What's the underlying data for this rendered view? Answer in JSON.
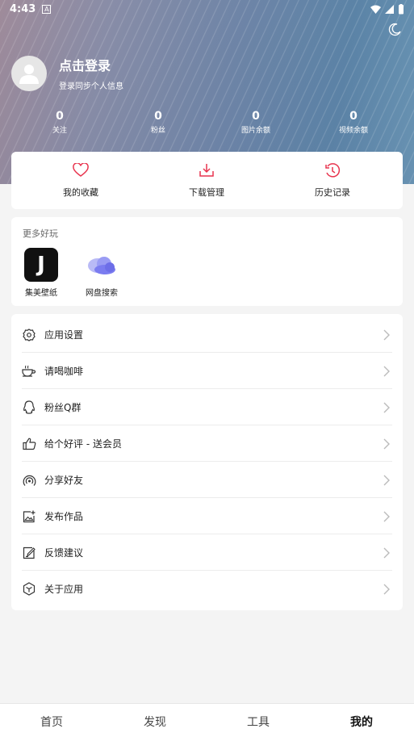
{
  "status_bar": {
    "time": "4:43",
    "notif_letter": "A"
  },
  "profile": {
    "title": "点击登录",
    "subtitle": "登录同步个人信息"
  },
  "stats": [
    {
      "value": "0",
      "label": "关注"
    },
    {
      "value": "0",
      "label": "粉丝"
    },
    {
      "value": "0",
      "label": "图片余额"
    },
    {
      "value": "0",
      "label": "视频余额"
    }
  ],
  "quick": [
    {
      "label": "我的收藏",
      "icon": "heart-icon"
    },
    {
      "label": "下载管理",
      "icon": "download-icon"
    },
    {
      "label": "历史记录",
      "icon": "history-icon"
    }
  ],
  "more": {
    "title": "更多好玩",
    "apps": [
      {
        "label": "集美壁纸",
        "icon": "j-wallpaper-icon",
        "letter": "J"
      },
      {
        "label": "网盘搜索",
        "icon": "cloud-icon"
      }
    ]
  },
  "menu": [
    {
      "label": "应用设置",
      "icon": "gear-icon"
    },
    {
      "label": "请喝咖啡",
      "icon": "coffee-icon"
    },
    {
      "label": "粉丝Q群",
      "icon": "qq-icon"
    },
    {
      "label": "给个好评 - 送会员",
      "icon": "thumbs-up-icon"
    },
    {
      "label": "分享好友",
      "icon": "share-signal-icon"
    },
    {
      "label": "发布作品",
      "icon": "image-add-icon"
    },
    {
      "label": "反馈建议",
      "icon": "edit-note-icon"
    },
    {
      "label": "关于应用",
      "icon": "hexagon-cube-icon"
    }
  ],
  "nav": [
    {
      "label": "首页"
    },
    {
      "label": "发现"
    },
    {
      "label": "工具"
    },
    {
      "label": "我的"
    }
  ],
  "colors": {
    "accent": "#e8344e",
    "cloud": "#7b7cf0"
  }
}
